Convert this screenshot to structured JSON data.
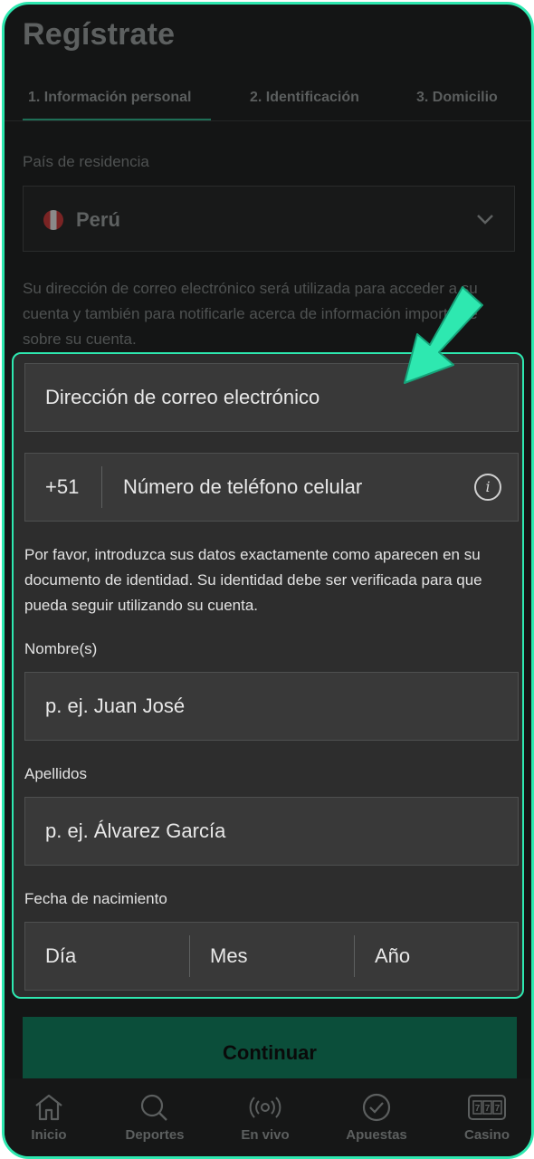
{
  "page": {
    "title": "Regístrate"
  },
  "tabs": [
    {
      "label": "1. Información personal",
      "active": true
    },
    {
      "label": "2. Identificación",
      "active": false
    },
    {
      "label": "3. Domicilio",
      "active": false
    }
  ],
  "country": {
    "label": "País de residencia",
    "value": "Perú"
  },
  "email_info": "Su dirección de correo electrónico será utilizada para acceder a su cuenta y también para notificarle acerca de información importante sobre su cuenta.",
  "form": {
    "email_placeholder": "Dirección de correo electrónico",
    "phone_prefix": "+51",
    "phone_placeholder": "Número de teléfono celular",
    "identity_note": "Por favor, introduzca sus datos exactamente como aparecen en su documento de identidad. Su identidad debe ser verificada para que pueda seguir utilizando su cuenta.",
    "name_label": "Nombre(s)",
    "name_placeholder": "p. ej. Juan José",
    "surname_label": "Apellidos",
    "surname_placeholder": "p. ej. Álvarez García",
    "dob_label": "Fecha de nacimiento",
    "dob_day": "Día",
    "dob_month": "Mes",
    "dob_year": "Año"
  },
  "continue_label": "Continuar",
  "nav": [
    {
      "label": "Inicio",
      "icon": "home-icon"
    },
    {
      "label": "Deportes",
      "icon": "search-icon"
    },
    {
      "label": "En vivo",
      "icon": "live-icon"
    },
    {
      "label": "Apuestas",
      "icon": "check-circle-icon"
    },
    {
      "label": "Casino",
      "icon": "slot-machine-icon"
    }
  ],
  "colors": {
    "accent": "#2ee8b0",
    "continue_bg": "#0b4e3a"
  }
}
